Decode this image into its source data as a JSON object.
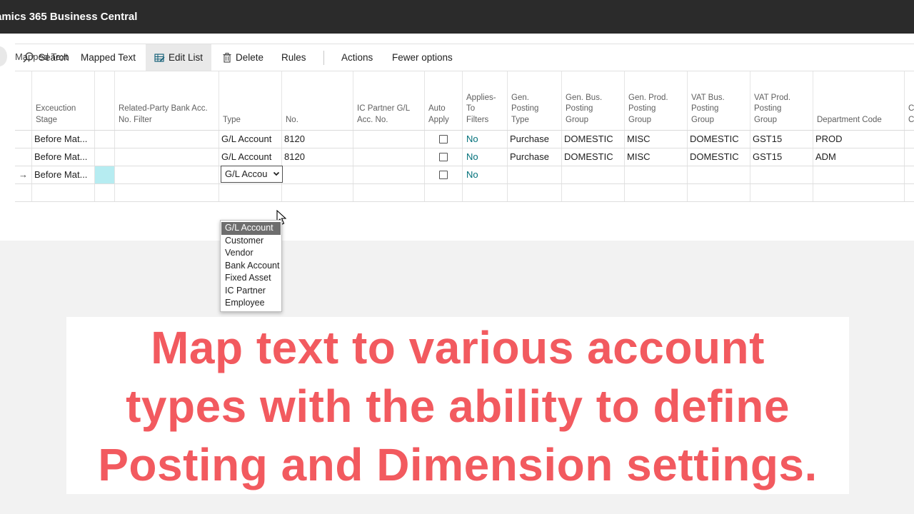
{
  "app": {
    "title": "amics 365 Business Central"
  },
  "page": {
    "title": "Mapped Text"
  },
  "actions": {
    "search": "Search",
    "mapped_text": "Mapped Text",
    "edit_list": "Edit List",
    "delete": "Delete",
    "rules": "Rules",
    "actions": "Actions",
    "fewer_options": "Fewer options"
  },
  "columns": [
    "Exceuction\nStage",
    "Related-Party Bank Acc.\nNo. Filter",
    "Type",
    "No.",
    "IC Partner G/L\nAcc. No.",
    "Auto\nApply",
    "Applies-\nTo\nFilters",
    "Gen.\nPosting\nType",
    "Gen. Bus.\nPosting\nGroup",
    "Gen. Prod.\nPosting\nGroup",
    "VAT Bus.\nPosting\nGroup",
    "VAT Prod.\nPosting\nGroup",
    "Department Code",
    "C\nC"
  ],
  "rows": [
    {
      "stage": "Before Mat...",
      "type": "G/L Account",
      "no": "8120",
      "applies": "No",
      "gen_posting_type": "Purchase",
      "gen_bus": "DOMESTIC",
      "gen_prod": "MISC",
      "vat_bus": "DOMESTIC",
      "vat_prod": "GST15",
      "department": "PROD"
    },
    {
      "stage": "Before Mat...",
      "type": "G/L Account",
      "no": "8120",
      "applies": "No",
      "gen_posting_type": "Purchase",
      "gen_bus": "DOMESTIC",
      "gen_prod": "MISC",
      "vat_bus": "DOMESTIC",
      "vat_prod": "GST15",
      "department": "ADM"
    },
    {
      "marker": "→",
      "stage": "Before Mat...",
      "type": "G/L Accou",
      "applies": "No"
    }
  ],
  "dropdown": {
    "options": [
      "G/L Account",
      "Customer",
      "Vendor",
      "Bank Account",
      "Fixed Asset",
      "IC Partner",
      "Employee"
    ],
    "selected": "G/L Account"
  },
  "caption": {
    "line1": "Map text to various account",
    "line2": "types with the ability to define",
    "line3": "Posting and Dimension settings."
  },
  "colors": {
    "topbar": "#2b2b2b",
    "link": "#00707a",
    "caption": "#f25a5f",
    "selection": "#b6ecf1"
  }
}
